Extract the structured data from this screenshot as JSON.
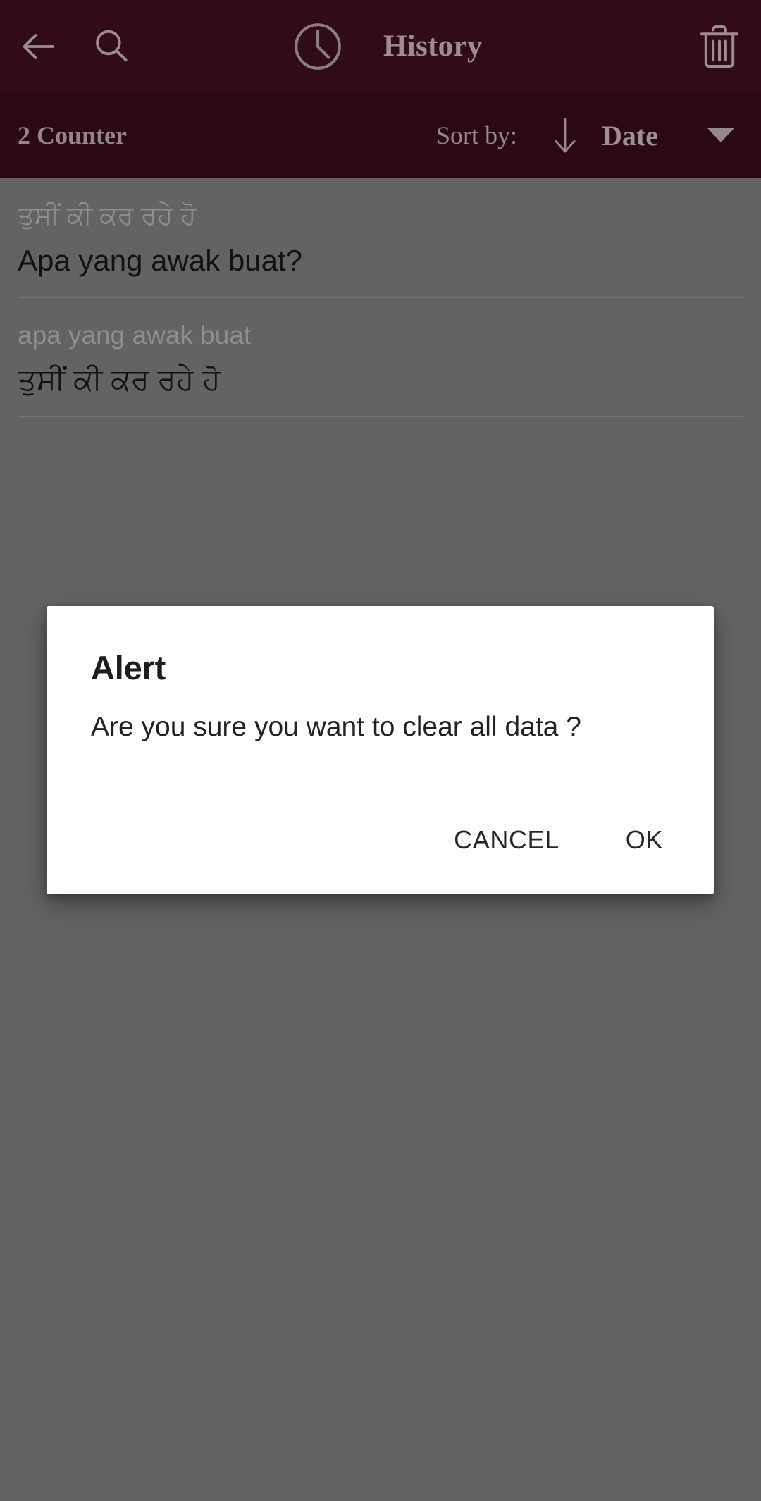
{
  "appbar": {
    "back_icon": "arrow-left-icon",
    "search_icon": "search-icon",
    "clock_icon": "clock-icon",
    "title": "History",
    "delete_icon": "trash-icon"
  },
  "sortbar": {
    "counter_label": "2 Counter",
    "sort_by_label": "Sort by:",
    "sort_direction_icon": "arrow-down-icon",
    "sort_value": "Date",
    "caret_icon": "caret-down-icon"
  },
  "history": {
    "items": [
      {
        "source": "ਤੁਸੀਂ ਕੀ ਕਰ ਰਹੇ ਹੋ",
        "target": "Apa yang awak buat?"
      },
      {
        "source": "apa yang awak buat",
        "target": "ਤੁਸੀਂ ਕੀ ਕਰ ਰਹੇ ਹੋ"
      }
    ]
  },
  "dialog": {
    "title": "Alert",
    "message": "Are you sure you want to clear all data ?",
    "cancel_label": "CANCEL",
    "ok_label": "OK"
  },
  "colors": {
    "appbar_background": "#2f0c17",
    "sortbar_background": "#2b0914",
    "appbar_foreground": "#9e8c91",
    "scrim_background": "#636363",
    "dialog_background": "#ffffff",
    "dialog_text": "#1d1d1d",
    "list_source_text": "#8e8e8e",
    "list_target_text": "#121212",
    "divider": "#767676"
  }
}
